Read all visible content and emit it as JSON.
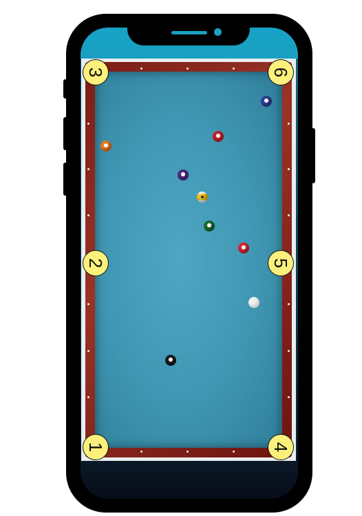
{
  "pockets": [
    {
      "id": "pocket-1",
      "label": "1"
    },
    {
      "id": "pocket-2",
      "label": "2"
    },
    {
      "id": "pocket-3",
      "label": "3"
    },
    {
      "id": "pocket-4",
      "label": "4"
    },
    {
      "id": "pocket-5",
      "label": "5"
    },
    {
      "id": "pocket-6",
      "label": "6"
    }
  ],
  "colors": {
    "felt": "#3f96b2",
    "rail": "#8a2a1f",
    "pocket_marker": "#fbf07c",
    "screen_accent": "#1aa0c2"
  },
  "balls": [
    {
      "name": "blue-ball",
      "color": "#2d3f9a"
    },
    {
      "name": "red-ball",
      "color": "#c8202a"
    },
    {
      "name": "orange-ball",
      "color": "#f07a1e"
    },
    {
      "name": "purple-ball",
      "color": "#4a2a86"
    },
    {
      "name": "yellow-striped-ball",
      "color": "#f2c21a"
    },
    {
      "name": "green-ball",
      "color": "#1d6b35"
    },
    {
      "name": "red-ball-2",
      "color": "#d8262f"
    },
    {
      "name": "cue-ball",
      "color": "#f1f1f1"
    },
    {
      "name": "eight-ball",
      "color": "#1a1a1a"
    }
  ]
}
